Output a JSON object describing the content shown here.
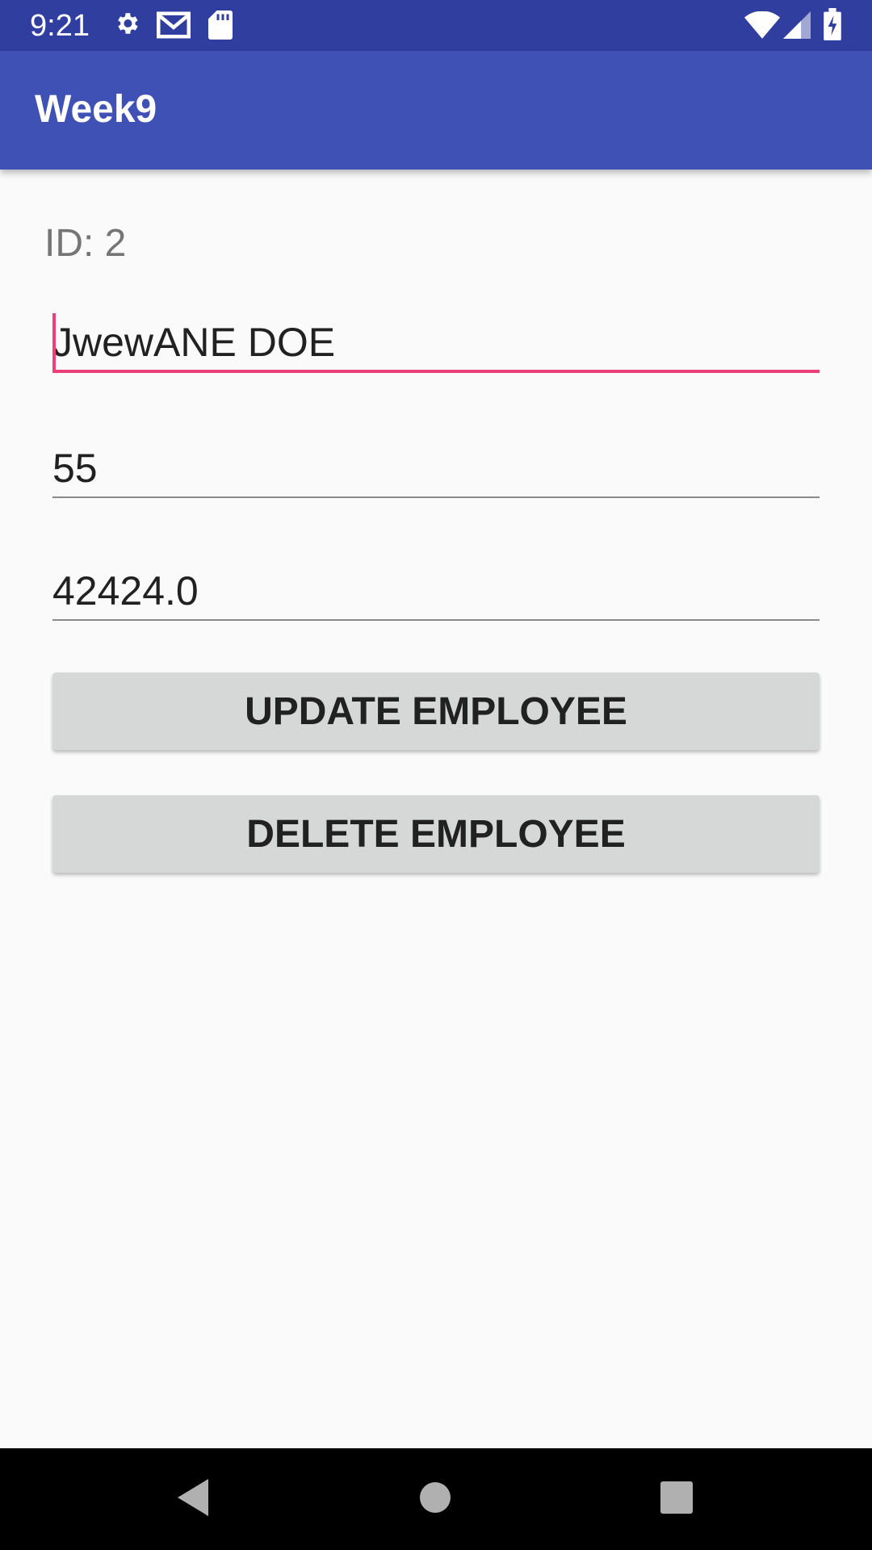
{
  "status_bar": {
    "time": "9:21",
    "left_icons": [
      "gear-icon",
      "gmail-icon",
      "sd-card-icon"
    ],
    "right_icons": [
      "wifi-icon",
      "signal-icon",
      "battery-charging-icon"
    ]
  },
  "app_bar": {
    "title": "Week9"
  },
  "form": {
    "id_label": "ID: 2",
    "name_value": "JwewANE DOE",
    "age_value": "55",
    "salary_value": "42424.0",
    "update_button_label": "UPDATE EMPLOYEE",
    "delete_button_label": "DELETE EMPLOYEE"
  },
  "nav_bar": {
    "icons": [
      "back-icon",
      "home-icon",
      "recents-icon"
    ]
  },
  "colors": {
    "status_bar": "#303f9f",
    "app_bar": "#3f51b5",
    "accent": "#ec407a",
    "button": "#d6d7d7",
    "background": "#fafafa"
  }
}
